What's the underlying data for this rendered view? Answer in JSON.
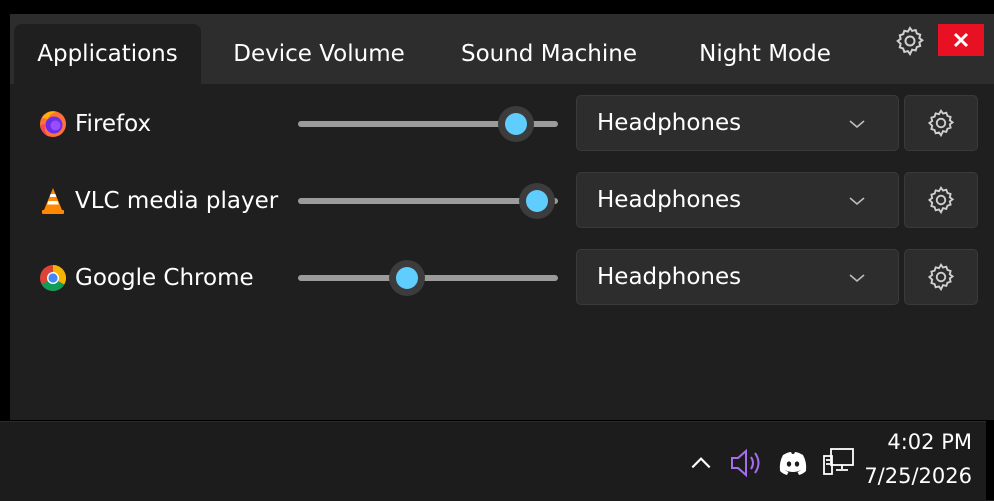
{
  "tabs": [
    {
      "label": "Applications",
      "active": true
    },
    {
      "label": "Device Volume",
      "active": false
    },
    {
      "label": "Sound Machine",
      "active": false
    },
    {
      "label": "Night Mode",
      "active": false
    }
  ],
  "header": {
    "settings_icon": "gear-icon",
    "close_icon": "close-icon"
  },
  "apps": [
    {
      "name": "Firefox",
      "icon": "firefox-icon",
      "volume": 0.84,
      "device": "Headphones"
    },
    {
      "name": "VLC media player",
      "icon": "vlc-icon",
      "volume": 0.92,
      "device": "Headphones"
    },
    {
      "name": "Google Chrome",
      "icon": "chrome-icon",
      "volume": 0.42,
      "device": "Headphones"
    }
  ],
  "taskbar": {
    "time": "4:02 PM",
    "date": "7/25/2026",
    "tray_icons": [
      "chevron-up-icon",
      "speaker-icon",
      "discord-icon",
      "network-icon"
    ]
  },
  "colors": {
    "accent": "#60cdff",
    "close": "#e81123",
    "background": "#1f1f1f",
    "tabbar": "#2d2d2d",
    "volume_icon": "#a86cf0"
  }
}
